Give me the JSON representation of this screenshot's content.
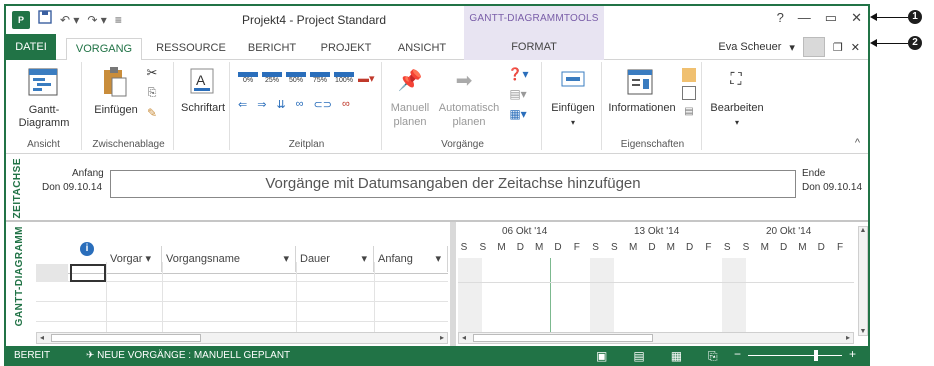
{
  "titlebar": {
    "app_icon": "P",
    "title": "Projekt4 - Project Standard",
    "contextual": "GANTT-DIAGRAMMTOOLS",
    "help": "?",
    "minimize": "—",
    "restore": "▭",
    "close": "✕"
  },
  "tabs": {
    "file": "DATEI",
    "items": [
      "VORGANG",
      "RESSOURCE",
      "BERICHT",
      "PROJEKT",
      "ANSICHT",
      "FORMAT"
    ],
    "user": "Eva Scheuer",
    "user_caret": "▾",
    "doc_restore": "❐",
    "doc_close": "✕"
  },
  "ribbon": {
    "ansicht": {
      "line1": "Gantt-",
      "line2": "Diagramm",
      "label": "Ansicht"
    },
    "zwischenablage": {
      "paste": "Einfügen",
      "label": "Zwischenablage"
    },
    "schriftart": {
      "button": "Schriftart",
      "label": ""
    },
    "zeitplan": {
      "percents": [
        "0%",
        "25%",
        "50%",
        "75%",
        "100%"
      ],
      "label": "Zeitplan"
    },
    "vorgaenge": {
      "manual1": "Manuell",
      "manual2": "planen",
      "auto1": "Automatisch",
      "auto2": "planen",
      "label": "Vorgänge"
    },
    "einfuegen": {
      "button": "Einfügen"
    },
    "eigenschaften": {
      "button": "Informationen",
      "label": "Eigenschaften"
    },
    "bearbeiten": {
      "button": "Bearbeiten"
    },
    "collapse": "^"
  },
  "timeline": {
    "side_label": "ZEITACHSE",
    "start_label": "Anfang",
    "start_date": "Don 09.10.14",
    "placeholder": "Vorgänge mit Datumsangaben der Zeitachse hinzufügen",
    "end_label": "Ende",
    "end_date": "Don 09.10.14"
  },
  "grid": {
    "side_label": "GANTT-DIAGRAMM",
    "info_icon": "i",
    "columns": [
      "Vorgar ▾",
      "Vorgangsname",
      "Dauer",
      "Anfang"
    ],
    "col_carets": [
      "▾",
      "▾",
      "▾"
    ]
  },
  "gantt": {
    "weeks": [
      "06 Okt '14",
      "13 Okt '14",
      "20 Okt '14"
    ],
    "days": [
      "S",
      "S",
      "M",
      "D",
      "M",
      "D",
      "F",
      "S",
      "S",
      "M",
      "D",
      "M",
      "D",
      "F",
      "S",
      "S",
      "M",
      "D",
      "M",
      "D",
      "F"
    ]
  },
  "statusbar": {
    "ready": "BEREIT",
    "mode": "✈ NEUE VORGÄNGE : MANUELL GEPLANT"
  },
  "callouts": [
    "1",
    "2"
  ],
  "colors": {
    "accent": "#217346",
    "contextual": "#e8e4f2"
  }
}
